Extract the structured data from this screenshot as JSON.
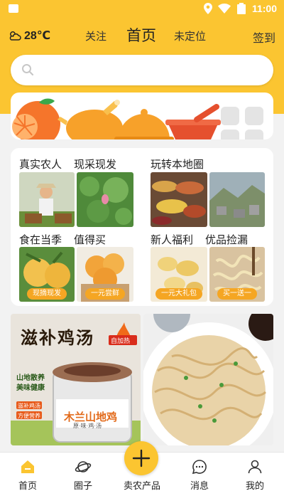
{
  "status": {
    "time": "11:00"
  },
  "header": {
    "temperature": "28℃",
    "follow_label": "关注",
    "home_label": "首页",
    "location_label": "未定位",
    "signin_label": "签到"
  },
  "search": {
    "placeholder": ""
  },
  "categories": [
    "orange-icon",
    "chicken-icon",
    "cloche-icon",
    "mortar-icon",
    "grid-icon"
  ],
  "promos": [
    {
      "title": "真实农人"
    },
    {
      "title": "现采现发"
    },
    {
      "title": "玩转本地圈"
    },
    {
      "title": "食在当季",
      "tag": "现摘现发"
    },
    {
      "title": "值得买",
      "tag": "一元尝鲜"
    },
    {
      "title": "新人福利",
      "tag": "一元大礼包"
    },
    {
      "title": "优品捡漏",
      "tag": "买一送一"
    }
  ],
  "feed": [
    {
      "headline": "滋补鸡汤",
      "badge": "自加热",
      "side_line1": "山地散养",
      "side_line2": "美味健康",
      "pill1": "滋补鸡汤",
      "pill2": "方便营养",
      "brand": "木兰山地鸡",
      "sub": "原·味·鸡·汤"
    },
    {}
  ],
  "tabbar": {
    "home": "首页",
    "circle": "圈子",
    "sell": "卖农产品",
    "messages": "消息",
    "mine": "我的"
  },
  "colors": {
    "accent": "#fbc531",
    "tag": "#f5a623"
  }
}
